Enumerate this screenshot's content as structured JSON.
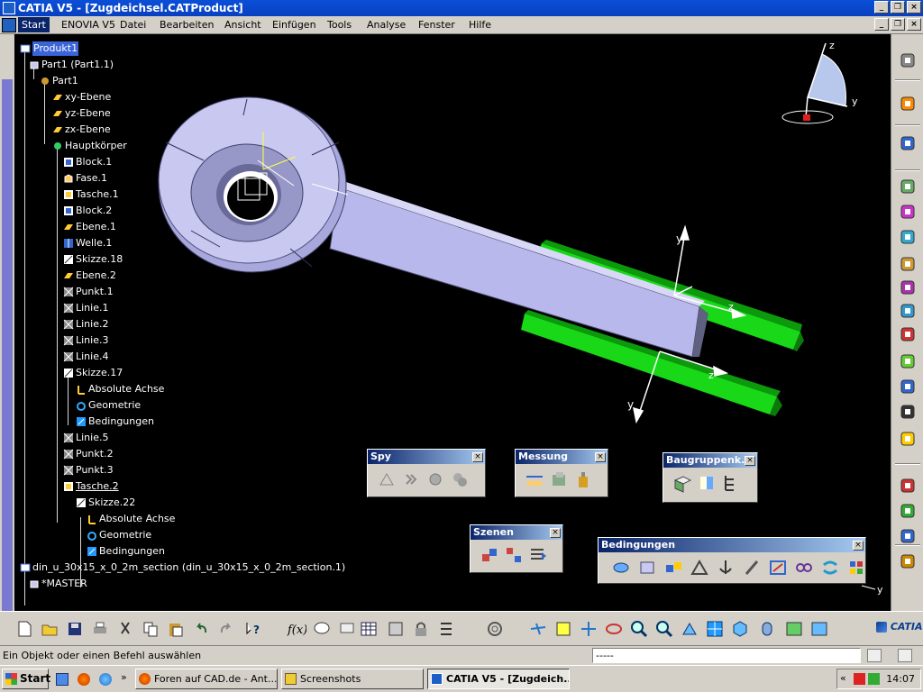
{
  "window": {
    "title": "CATIA V5 - [Zugdeichsel.CATProduct]"
  },
  "menu": {
    "items": [
      "Start",
      "ENOVIA V5",
      "Datei",
      "Bearbeiten",
      "Ansicht",
      "Einfügen",
      "Tools",
      "Analyse",
      "Fenster",
      "Hilfe"
    ],
    "active": "Start"
  },
  "tree": {
    "nodes": [
      {
        "label": "Produkt1",
        "selected": true
      },
      {
        "label": "Part1 (Part1.1)"
      },
      {
        "label": "Part1"
      },
      {
        "label": "xy-Ebene"
      },
      {
        "label": "yz-Ebene"
      },
      {
        "label": "zx-Ebene"
      },
      {
        "label": "Hauptkörper"
      },
      {
        "label": "Block.1"
      },
      {
        "label": "Fase.1"
      },
      {
        "label": "Tasche.1"
      },
      {
        "label": "Block.2"
      },
      {
        "label": "Ebene.1"
      },
      {
        "label": "Welle.1"
      },
      {
        "label": "Skizze.18"
      },
      {
        "label": "Ebene.2"
      },
      {
        "label": "Punkt.1"
      },
      {
        "label": "Linie.1"
      },
      {
        "label": "Linie.2"
      },
      {
        "label": "Linie.3"
      },
      {
        "label": "Linie.4"
      },
      {
        "label": "Skizze.17"
      },
      {
        "label": "Absolute Achse"
      },
      {
        "label": "Geometrie"
      },
      {
        "label": "Bedingungen"
      },
      {
        "label": "Linie.5"
      },
      {
        "label": "Punkt.2"
      },
      {
        "label": "Punkt.3"
      },
      {
        "label": "Tasche.2",
        "underlined": true
      },
      {
        "label": "Skizze.22"
      },
      {
        "label": "Absolute Achse"
      },
      {
        "label": "Geometrie"
      },
      {
        "label": "Bedingungen"
      },
      {
        "label": "din_u_30x15_x_0_2m_section (din_u_30x15_x_0_2m_section.1)"
      },
      {
        "label": "*MASTER"
      }
    ]
  },
  "compass": {
    "axis_z": "z",
    "axis_y": "y"
  },
  "scene_axes": {
    "y1": "y",
    "z1": "z",
    "y2": "y",
    "z2": "z",
    "corner_y": "y"
  },
  "palettes": {
    "spy": {
      "title": "Spy"
    },
    "messung": {
      "title": "Messung"
    },
    "baugruppen": {
      "title": "Baugruppenk..."
    },
    "szenen": {
      "title": "Szenen"
    },
    "bedingungen": {
      "title": "Bedingungen"
    }
  },
  "status": {
    "text": "Ein Objekt oder einen Befehl auswählen",
    "command_value": "-----"
  },
  "brand": {
    "logo_text": "CATIA"
  },
  "taskbar": {
    "start_label": "Start",
    "tasks": [
      "Foren auf CAD.de - Ant...",
      "Screenshots",
      "CATIA V5 - [Zugdeich..."
    ],
    "clock": "14:07"
  },
  "colors": {
    "part": "#b4b4e8",
    "profile": "#18d818",
    "viewport": "#000000",
    "titlebar": "#0a4fd8",
    "tree_text": "#ffffff"
  }
}
